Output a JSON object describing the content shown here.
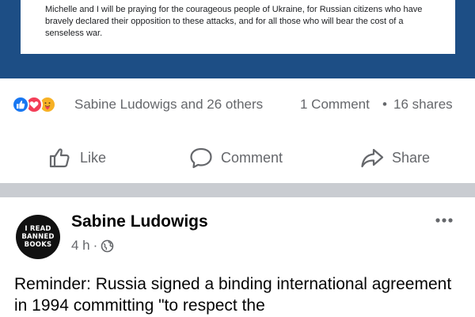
{
  "shared_post": {
    "statement": "Michelle and I will be praying for the courageous people of Ukraine, for Russian citizens who have bravely declared their opposition to these attacks, and for all those who will bear the cost of a senseless war."
  },
  "reactions_summary": {
    "reaction_icons": [
      "like-icon",
      "love-icon",
      "care-icon"
    ],
    "reactors_text": "Sabine Ludowigs and 26 others",
    "comments_text": "1 Comment",
    "separator": "•",
    "shares_text": "16 shares"
  },
  "actions": {
    "like_label": "Like",
    "comment_label": "Comment",
    "share_label": "Share"
  },
  "next_post": {
    "avatar_lines": [
      "I READ",
      "BANNED",
      "BOOKS"
    ],
    "author": "Sabine Ludowigs",
    "time": "4 h",
    "meta_separator": "·",
    "audience_icon": "globe-icon",
    "more_icon": "more-dots-icon",
    "text": "Reminder: Russia signed a binding international agreement in 1994 committing \"to respect the"
  },
  "colors": {
    "frame_blue": "#1d4e85",
    "like_blue": "#1877f2",
    "love_red": "#f33e58",
    "care_yellow": "#f7b125",
    "secondary_text": "#65676b",
    "divider": "#c9ccd1"
  }
}
